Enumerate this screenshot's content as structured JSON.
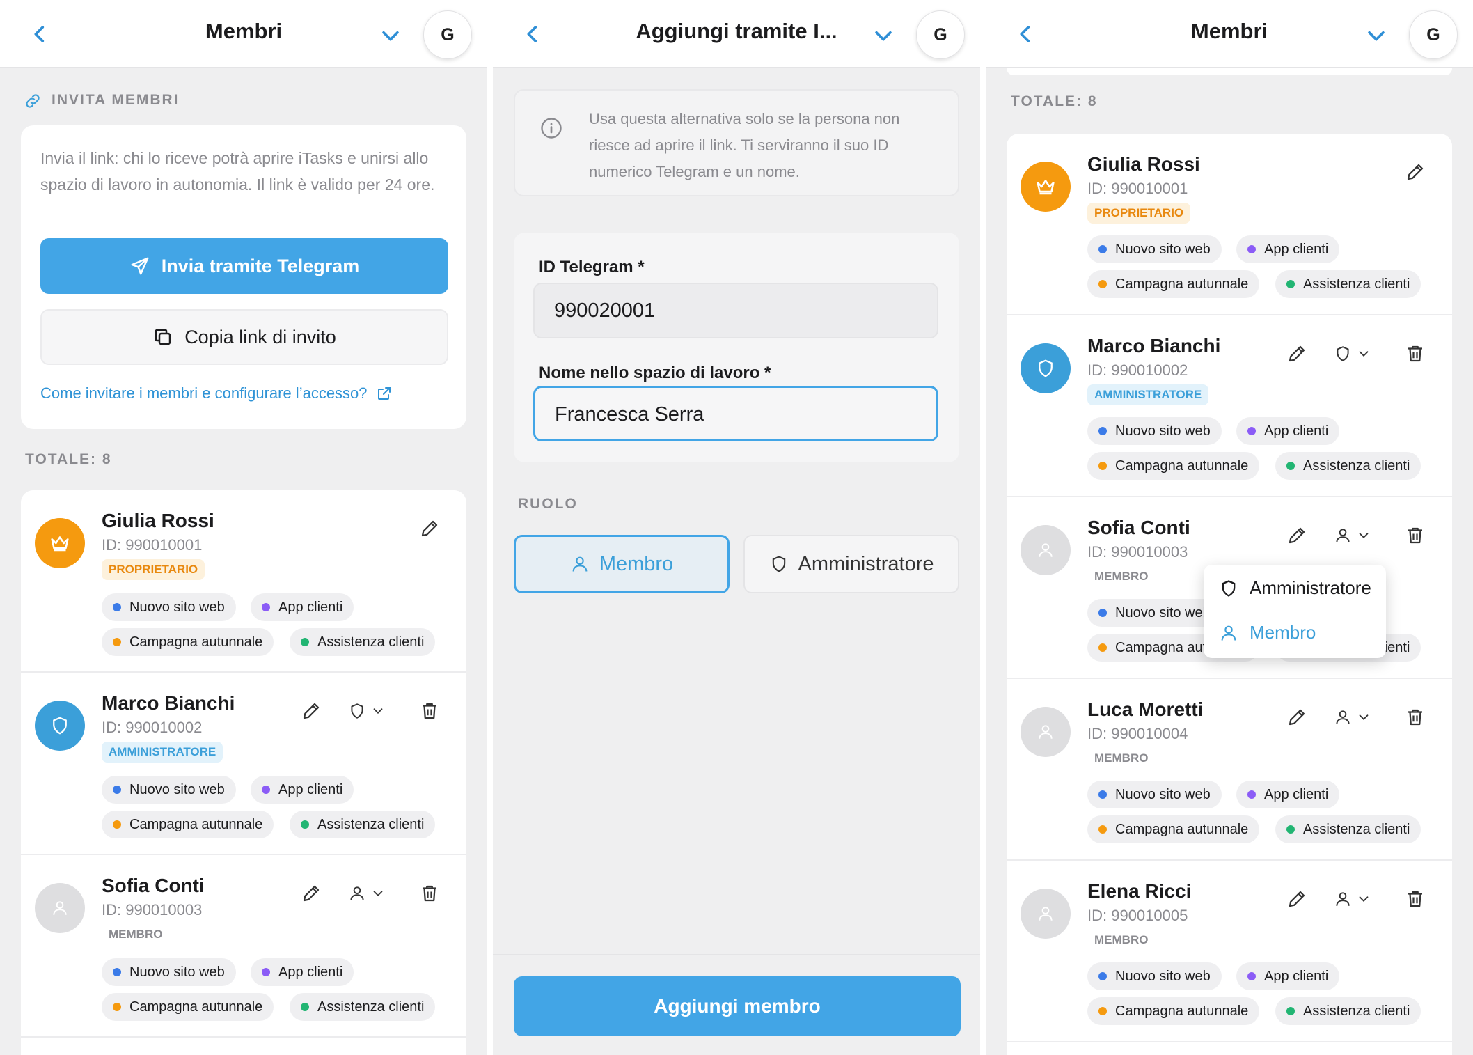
{
  "colors": {
    "accent": "#42a5e6",
    "owner": "#f59a0f",
    "admin": "#3b9fd9",
    "project_blue": "#3b7be8",
    "project_purple": "#8b5cf6",
    "project_orange": "#f59a0f",
    "project_green": "#22b573"
  },
  "panel1": {
    "title": "Membri",
    "avatar_letter": "G",
    "invite_section": "INVITA MEMBRI",
    "invite_description": "Invia il link: chi lo riceve potrà aprire iTasks e unirsi allo spazio di lavoro in autonomia. Il link è valido per 24 ore.",
    "telegram_button": "Invia tramite Telegram",
    "copy_button": "Copia link di invito",
    "help_link": "Come invitare i membri e configurare l’accesso?",
    "total": "TOTALE: 8"
  },
  "panel2": {
    "title": "Aggiungi tramite I...",
    "avatar_letter": "G",
    "info_text": "Usa questa alternativa solo se la persona non riesce ad aprire il link. Ti serviranno il suo ID numerico Telegram e un nome.",
    "telegram_id_label": "ID Telegram *",
    "telegram_id_value": "990020001",
    "name_label": "Nome nello spazio di lavoro *",
    "name_value": "Francesca Serra",
    "role_section": "RUOLO",
    "role_member": "Membro",
    "role_admin": "Amministratore",
    "add_button": "Aggiungi membro"
  },
  "panel3": {
    "title": "Membri",
    "avatar_letter": "G",
    "total": "TOTALE: 8",
    "dropdown": {
      "admin": "Amministratore",
      "member": "Membro"
    }
  },
  "projects": {
    "p1": "Nuovo sito web",
    "p2": "App clienti",
    "p3": "Campagna autunnale",
    "p4": "Assistenza clienti"
  },
  "members": [
    {
      "name": "Giulia Rossi",
      "id": "ID: 990010001",
      "role": "PROPRIETARIO"
    },
    {
      "name": "Marco Bianchi",
      "id": "ID: 990010002",
      "role": "AMMINISTRATORE"
    },
    {
      "name": "Sofia Conti",
      "id": "ID: 990010003",
      "role": "MEMBRO"
    },
    {
      "name": "Luca Moretti",
      "id": "ID: 990010004",
      "role": "MEMBRO"
    },
    {
      "name": "Elena Ricci",
      "id": "ID: 990010005",
      "role": "MEMBRO"
    }
  ],
  "icons": [
    "chevron-left-icon",
    "chevron-down-icon",
    "link-icon",
    "send-icon",
    "copy-icon",
    "external-link-icon",
    "crown-icon",
    "shield-icon",
    "user-icon",
    "pencil-icon",
    "trash-icon",
    "info-icon"
  ]
}
